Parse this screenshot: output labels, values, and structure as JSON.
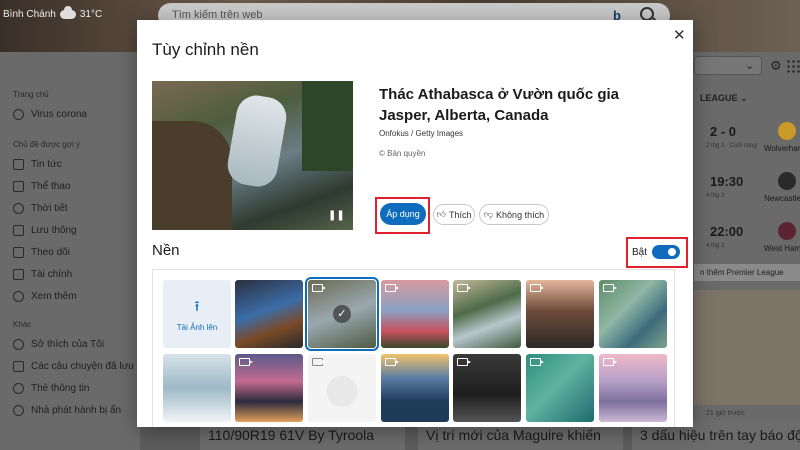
{
  "header": {
    "weather": {
      "location": "Bình Chánh",
      "temperature": "31°C",
      "icon": "cloud-sun-icon"
    },
    "search": {
      "placeholder": "Tìm kiếm trên web",
      "brand": "b"
    }
  },
  "sidebar": {
    "sections": [
      {
        "heading": "Trang chủ",
        "items": [
          {
            "label": "Virus corona",
            "icon": "globe-icon"
          }
        ]
      },
      {
        "heading": "Chủ đề được gợi ý",
        "items": [
          {
            "label": "Tin tức",
            "icon": "news-icon"
          },
          {
            "label": "Thể thao",
            "icon": "trophy-icon"
          },
          {
            "label": "Thời tiết",
            "icon": "cloud-icon"
          },
          {
            "label": "Lưu thông",
            "icon": "car-icon"
          },
          {
            "label": "Theo dõi",
            "icon": "tv-icon"
          },
          {
            "label": "Tài chính",
            "icon": "chart-icon"
          },
          {
            "label": "Xem thêm",
            "icon": "chevron-down-icon"
          }
        ]
      },
      {
        "heading": "Khác",
        "items": [
          {
            "label": "Sở thích của Tôi",
            "icon": "settings-icon"
          },
          {
            "label": "Các câu chuyện đã lưu",
            "icon": "bookmark-icon"
          },
          {
            "label": "Thẻ thông tin",
            "icon": "gear-icon"
          },
          {
            "label": "Nhà phát hành bị ẩn",
            "icon": "block-icon"
          }
        ]
      }
    ]
  },
  "right_panel": {
    "league": "LEAGUE",
    "matches": [
      {
        "score": "2 - 0",
        "detail": "2 thg 3 · Cuối cùng",
        "team": "Wolverhar"
      },
      {
        "score": "19:30",
        "detail": "4 thg 3",
        "team": "Newcastle"
      },
      {
        "score": "22:00",
        "detail": "4 thg 3",
        "team": "West Ham"
      }
    ],
    "more_link": "n thêm Premier League",
    "time_ago": "21 giờ trước"
  },
  "news": [
    "110/90R19 61V By Tyroola",
    "Vị trí mới của Maguire khiến",
    "3 dấu hiệu trên tay báo độ"
  ],
  "dialog": {
    "title": "Tùy chỉnh nền",
    "image_title": "Thác Athabasca ở Vườn quốc gia Jasper, Alberta, Canada",
    "credit": "Onfokus / Getty Images",
    "copyright": "© Bản quyền",
    "buttons": {
      "apply": "Áp dụng",
      "like": "Thích",
      "dislike": "Không thích"
    },
    "section_title": "Nền",
    "toggle": {
      "label": "Bật",
      "state": "on"
    },
    "upload_label": "Tải Ảnh lên",
    "accent": "#0f6cbd",
    "highlight": "#e0202a"
  }
}
